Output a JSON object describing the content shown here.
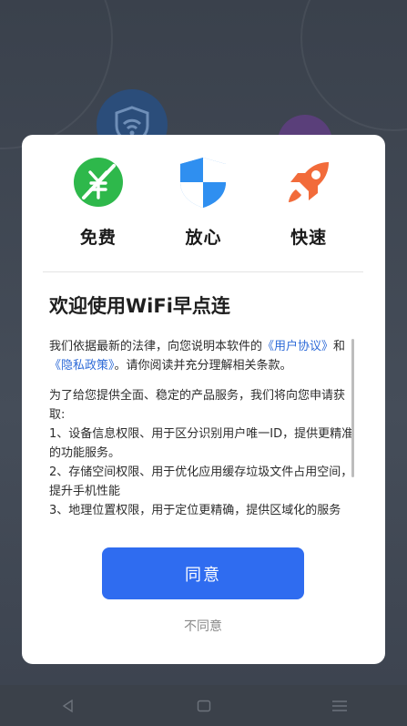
{
  "features": [
    {
      "icon": "free-icon",
      "label": "免费"
    },
    {
      "icon": "shield-icon",
      "label": "放心"
    },
    {
      "icon": "rocket-icon",
      "label": "快速"
    }
  ],
  "dialog": {
    "title": "欢迎使用WiFi早点连",
    "para1": {
      "prefix": "我们依据最新的法律，向您说明本软件的",
      "link1": "《用户协议》",
      "middle": "和",
      "link2": "《隐私政策》",
      "suffix": "。请你阅读并充分理解相关条款。"
    },
    "para2": {
      "intro": "为了给您提供全面、稳定的产品服务，我们将向您申请获取:",
      "item1": "1、设备信息权限、用于区分识别用户唯一ID，提供更精准的功能服务。",
      "item2": "2、存储空间权限、用于优化应用缓存垃圾文件占用空间，提升手机性能",
      "item3": "3、地理位置权限，用于定位更精确，提供区域化的服务"
    },
    "agree_label": "同意",
    "disagree_label": "不同意"
  },
  "colors": {
    "accent": "#2f6cf0",
    "link": "#2e6bd8",
    "free_green": "#2eb84b",
    "shield_blue": "#2f8ff0",
    "rocket_orange": "#f26b3a"
  },
  "navbar": [
    "back-icon",
    "home-icon",
    "menu-icon"
  ]
}
